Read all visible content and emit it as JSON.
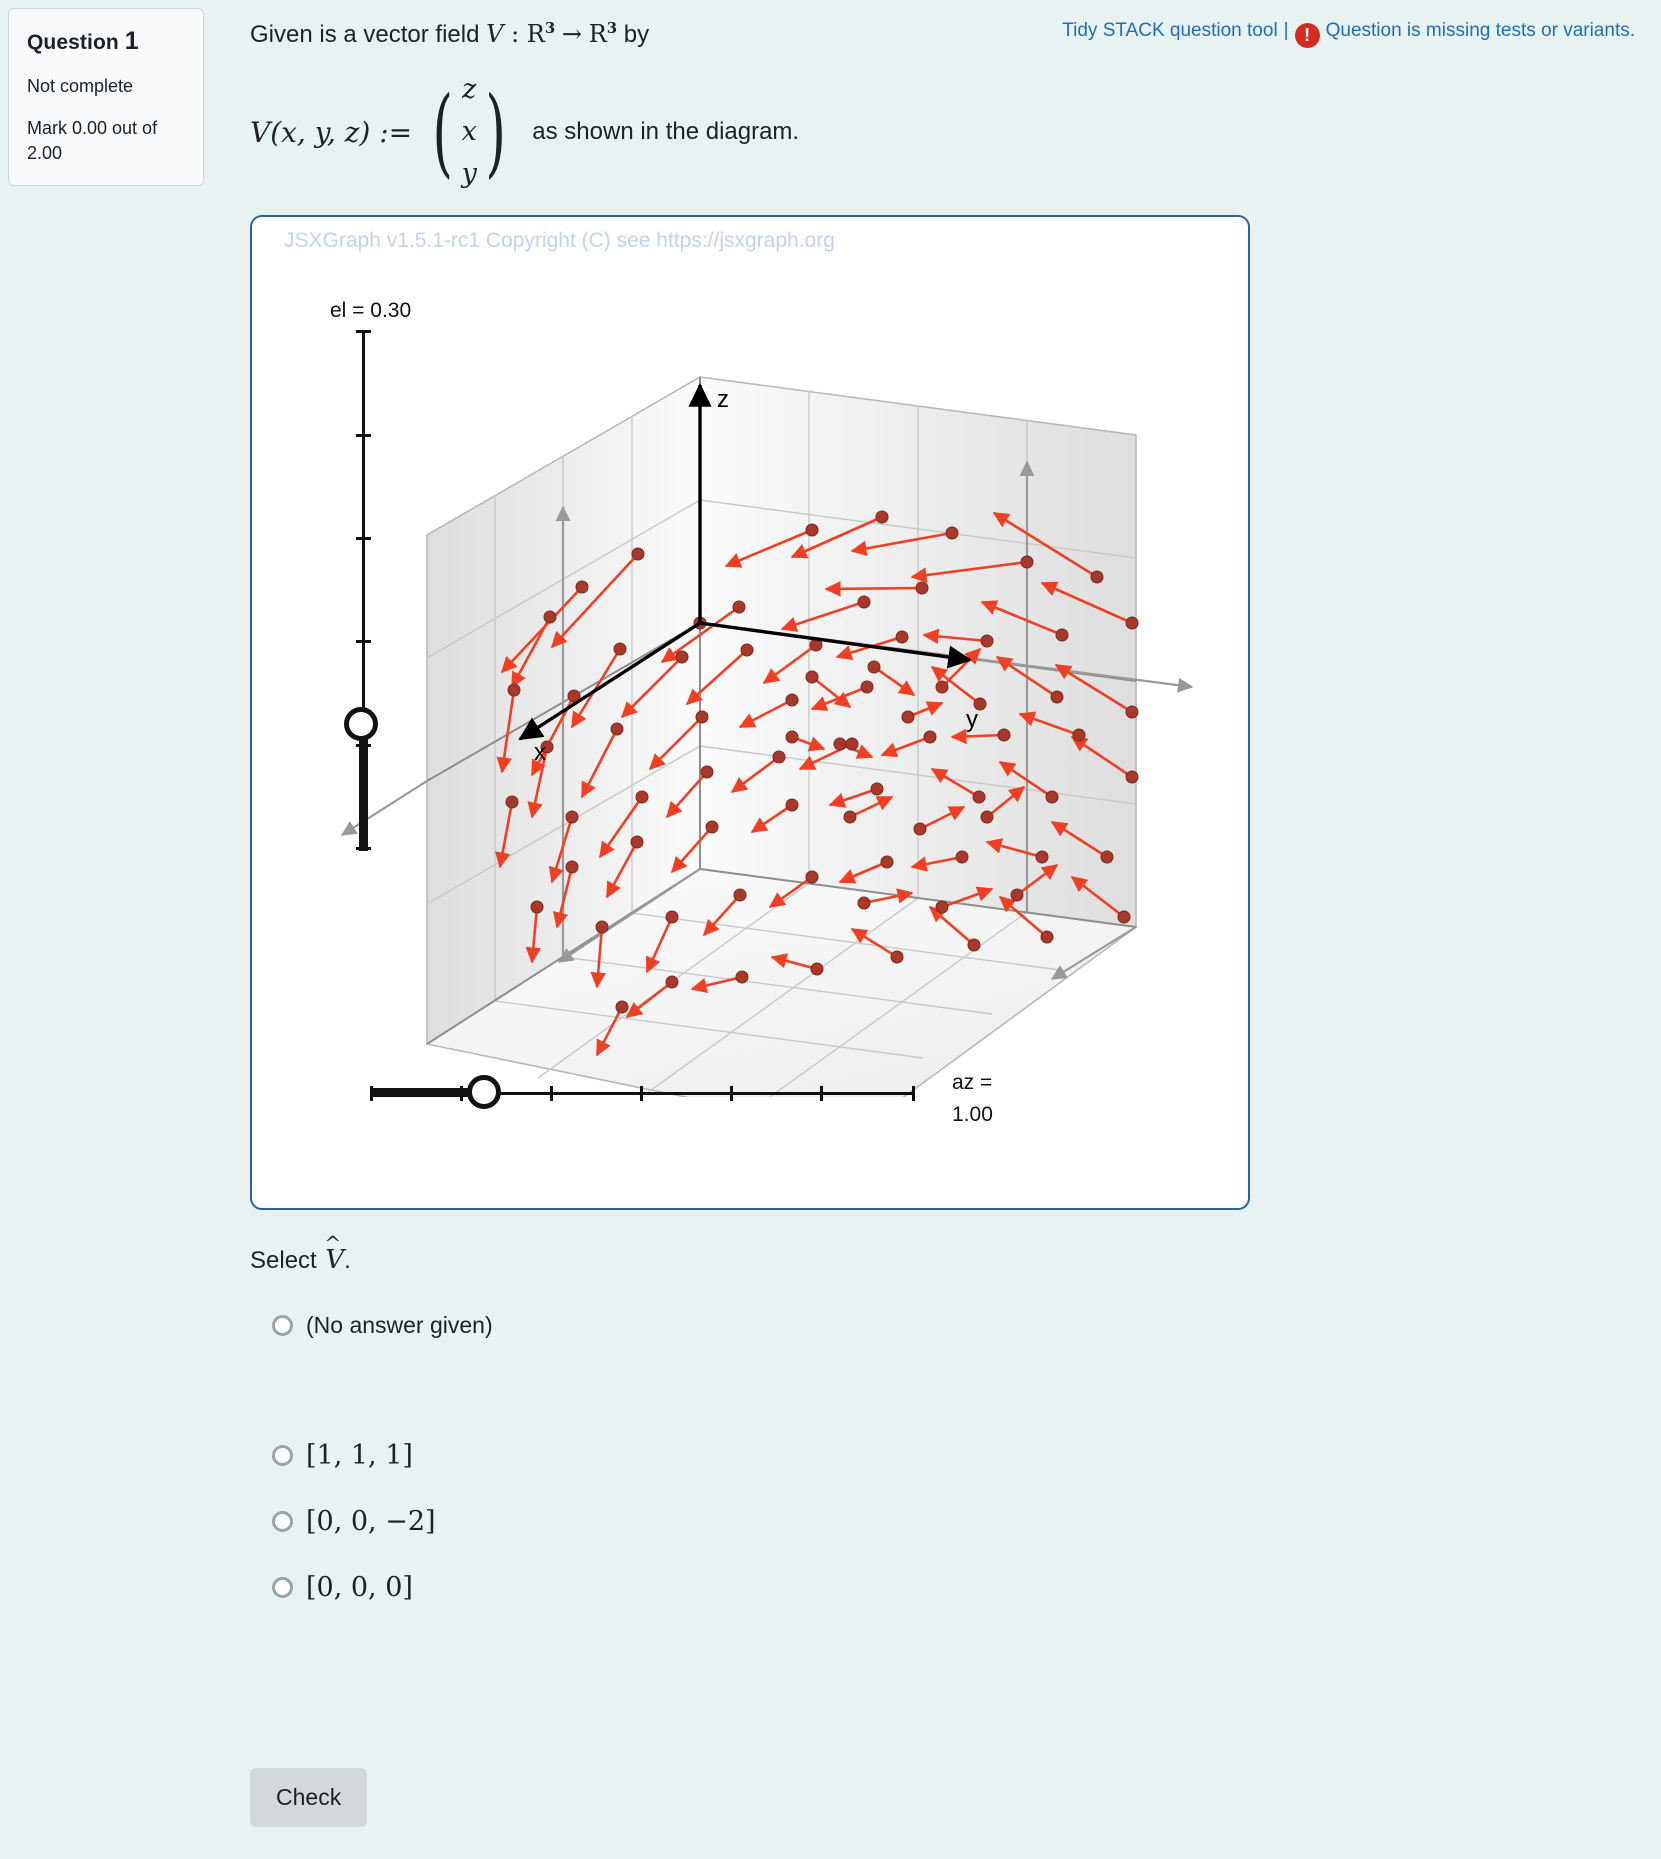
{
  "sidebar": {
    "question_label": "Question",
    "question_number": "1",
    "status": "Not complete",
    "mark": "Mark 0.00 out of 2.00"
  },
  "header": {
    "tidy_link": "Tidy STACK question tool",
    "separator": "|",
    "error_icon": "exclamation-circle-icon",
    "error_message": "Question is missing tests or variants.",
    "link_color": "#1d6fb8",
    "error_color": "#d42a22"
  },
  "stem": {
    "line1_pre": "Given is a vector field ",
    "field_name": "V",
    "colon": " : ",
    "domain": "R",
    "exponent": "3",
    "arrow": "→",
    "codomain": "R",
    "line1_post": " by",
    "definition_lhs": "V(x, y, z) :=",
    "matrix_rows": [
      "z",
      "x",
      "y"
    ],
    "line2_post": "as shown in the diagram."
  },
  "diagram": {
    "copyright": "JSXGraph v1.5.1-rc1 Copyright (C) see https://jsxgraph.org",
    "axis_labels": {
      "x": "x",
      "y": "y",
      "z": "z"
    },
    "el_slider": {
      "label": "el = 0.30",
      "name": "el",
      "value": "0.30"
    },
    "az_slider": {
      "label_line1": "az =",
      "label_line2": "1.00",
      "name": "az",
      "value": "1.00"
    },
    "vector_color": "#ef4024",
    "point_color": "#a8382a",
    "axis_color": "#000000"
  },
  "chart_data": {
    "type": "scatter",
    "title": "3D vector field V(x,y,z) = (z, x, y)",
    "xlabel": "x",
    "ylabel": "y",
    "zlabel": "z",
    "grid": true,
    "projection": {
      "elevation": 0.3,
      "azimuth": 1.0
    },
    "arrows": [
      {
        "x": -1.5,
        "y": -1.5,
        "z": 1.5,
        "u": 1.5,
        "v": -1.5,
        "w": -1.5
      },
      {
        "x": -1.0,
        "y": -1.5,
        "z": 1.5,
        "u": 1.5,
        "v": -1.0,
        "w": -1.5
      },
      {
        "x": -0.5,
        "y": -1.5,
        "z": 1.5,
        "u": 1.5,
        "v": -0.5,
        "w": -1.5
      },
      {
        "x": 0.0,
        "y": -1.5,
        "z": 1.5,
        "u": 1.5,
        "v": 0.0,
        "w": -1.5
      },
      {
        "x": 0.5,
        "y": -1.5,
        "z": 1.5,
        "u": 1.5,
        "v": 0.5,
        "w": -1.5
      },
      {
        "x": 1.0,
        "y": -1.0,
        "z": 1.5,
        "u": 1.5,
        "v": 1.0,
        "w": -1.0
      },
      {
        "x": 1.5,
        "y": -0.5,
        "z": 1.5,
        "u": 1.5,
        "v": 1.5,
        "w": -0.5
      },
      {
        "x": 1.5,
        "y": 0.0,
        "z": 1.0,
        "u": 1.0,
        "v": 1.5,
        "w": 0.0
      },
      {
        "x": 1.5,
        "y": 0.5,
        "z": 0.5,
        "u": 0.5,
        "v": 1.5,
        "w": 0.5
      },
      {
        "x": 1.5,
        "y": 1.0,
        "z": 0.0,
        "u": 0.0,
        "v": 1.5,
        "w": 1.0
      },
      {
        "x": 1.0,
        "y": 1.5,
        "z": -0.5,
        "u": -0.5,
        "v": 1.0,
        "w": 1.5
      },
      {
        "x": 0.5,
        "y": 1.5,
        "z": -1.0,
        "u": -1.0,
        "v": 0.5,
        "w": 1.5
      },
      {
        "x": 0.0,
        "y": 1.5,
        "z": -1.5,
        "u": -1.5,
        "v": 0.0,
        "w": 1.5
      },
      {
        "x": -0.5,
        "y": 1.0,
        "z": -1.5,
        "u": -1.5,
        "v": -0.5,
        "w": 1.0
      },
      {
        "x": -1.0,
        "y": 0.5,
        "z": -1.5,
        "u": -1.5,
        "v": -1.0,
        "w": 0.5
      },
      {
        "x": -1.5,
        "y": 0.0,
        "z": -1.5,
        "u": -1.5,
        "v": -1.5,
        "w": 0.0
      },
      {
        "x": -1.5,
        "y": -0.5,
        "z": -1.0,
        "u": -1.0,
        "v": -1.5,
        "w": -0.5
      },
      {
        "x": -1.5,
        "y": -1.0,
        "z": -0.5,
        "u": -0.5,
        "v": -1.5,
        "w": -1.0
      },
      {
        "x": -0.8,
        "y": -0.8,
        "z": 0.8,
        "u": 0.8,
        "v": -0.8,
        "w": -0.8
      },
      {
        "x": 0.0,
        "y": -0.8,
        "z": 0.8,
        "u": 0.8,
        "v": 0.0,
        "w": -0.8
      },
      {
        "x": 0.8,
        "y": -0.8,
        "z": 0.8,
        "u": 0.8,
        "v": 0.8,
        "w": -0.8
      },
      {
        "x": 0.8,
        "y": 0.0,
        "z": 0.8,
        "u": 0.8,
        "v": 0.8,
        "w": 0.0
      },
      {
        "x": 0.8,
        "y": 0.8,
        "z": 0.0,
        "u": 0.0,
        "v": 0.8,
        "w": 0.8
      },
      {
        "x": 0.0,
        "y": 0.8,
        "z": -0.8,
        "u": -0.8,
        "v": 0.0,
        "w": 0.8
      },
      {
        "x": -0.8,
        "y": 0.8,
        "z": -0.8,
        "u": -0.8,
        "v": -0.8,
        "w": 0.8
      },
      {
        "x": -0.8,
        "y": 0.0,
        "z": -0.8,
        "u": -0.8,
        "v": -0.8,
        "w": 0.0
      },
      {
        "x": -0.4,
        "y": -0.4,
        "z": 0.4,
        "u": 0.4,
        "v": -0.4,
        "w": -0.4
      },
      {
        "x": 0.4,
        "y": -0.4,
        "z": 0.4,
        "u": 0.4,
        "v": 0.4,
        "w": -0.4
      },
      {
        "x": 0.4,
        "y": 0.4,
        "z": 0.0,
        "u": 0.0,
        "v": 0.4,
        "w": 0.4
      },
      {
        "x": -0.4,
        "y": 0.4,
        "z": -0.4,
        "u": -0.4,
        "v": -0.4,
        "w": 0.4
      }
    ]
  },
  "answer": {
    "prompt_pre": "Select ",
    "prompt_symbol": "V",
    "prompt_post": ".",
    "options": [
      {
        "id": "none",
        "label": "(No answer given)",
        "math": false,
        "selected": false
      },
      {
        "id": "opt1",
        "label": "[1, 1, 1]",
        "math": true,
        "selected": false
      },
      {
        "id": "opt2",
        "label": "[0, 0, −2]",
        "math": true,
        "selected": false
      },
      {
        "id": "opt3",
        "label": "[0, 0, 0]",
        "math": true,
        "selected": false
      }
    ]
  },
  "actions": {
    "check_label": "Check"
  }
}
